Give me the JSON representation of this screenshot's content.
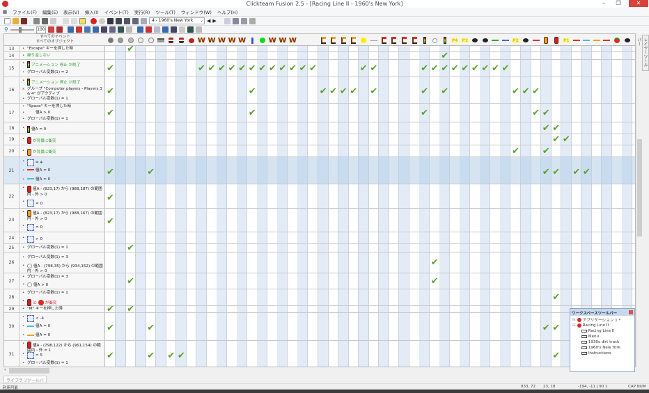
{
  "window": {
    "title": "Clickteam Fusion 2.5 - [Racing Line II - 1960's New York]",
    "minimize": "–",
    "maximize": "❐",
    "close": "✕"
  },
  "menu": [
    "ファイル(F)",
    "編集(E)",
    "表示(V)",
    "挿入(I)",
    "イベント(T)",
    "実行(R)",
    "ツール(T)",
    "ウィンドウ(W)",
    "ヘルプ(H)"
  ],
  "toolbar": {
    "frame_select": "4 - 1960's New York",
    "zoom": "100"
  },
  "header": {
    "events": "すべてのイベント",
    "objects": "すべてのオブジェクト"
  },
  "columns": [
    "gear",
    "spider",
    "storyboard",
    "clock",
    "create",
    "keyboard",
    "joystick",
    "joystick",
    "red-ball",
    "W",
    "W",
    "W",
    "W",
    "W",
    "blue-bar",
    "green-circle",
    "W",
    "W",
    "W",
    "blank",
    "blank",
    "orange-flag",
    "orange-flag",
    "orange-flag",
    "orange-flag",
    "yellow-circle",
    "dash-line",
    "red-flag",
    "red-flag",
    "red-flag",
    "red-flag",
    "traffic-light",
    "circle-outline",
    "traffic-light",
    "P4",
    "P3",
    "black-dot",
    "black-dot",
    "green-line",
    "blue-line",
    "P2",
    "black-dot",
    "red-line",
    "orange-car",
    "red-car",
    "P1",
    "red-line",
    "cyan-line",
    "orange-line",
    "red-line",
    "tomato",
    "black-dot",
    "red-flag"
  ],
  "colors": {
    "check": "#5aa02c",
    "green_text": "#2e9e2e",
    "red_text": "#d42020",
    "selected_row": "#dce8f4",
    "alt_column": "#e3ebf7"
  },
  "rows": [
    {
      "num": "13",
      "checks": [
        2
      ],
      "conds": [
        {
          "b": "•",
          "parts": [
            {
              "text": "\"Escape\" キーを押した時"
            }
          ]
        }
      ]
    },
    {
      "num": "14",
      "checks": [
        33
      ],
      "conds": [
        {
          "b": "•",
          "color": "green",
          "parts": [
            {
              "text": "繰り返しない"
            }
          ]
        }
      ]
    },
    {
      "num": "15",
      "checks": [
        0,
        9,
        10,
        11,
        12,
        13,
        14,
        15,
        16,
        17,
        18,
        19,
        20,
        25,
        26,
        31,
        32,
        33,
        34,
        35,
        36,
        37,
        38,
        39
      ],
      "conds": [
        {
          "b": "•",
          "color": "green",
          "parts": [
            {
              "icon": "traffic-light"
            },
            {
              "text": "アニメーション 停止 が終了"
            }
          ]
        },
        {
          "b": "•",
          "parts": [
            {
              "text": "グローバル変数(1) = 2"
            }
          ]
        }
      ]
    },
    {
      "num": "16",
      "checks": [
        0,
        14,
        21,
        22,
        23,
        24,
        26,
        31,
        33,
        40,
        41,
        42
      ],
      "conds": [
        {
          "b": "•",
          "color": "green",
          "parts": [
            {
              "icon": "traffic-light"
            },
            {
              "text": "アニメーション 停止 が終了"
            }
          ]
        },
        {
          "b": "x",
          "parts": [
            {
              "text": "グループ \"Computer players - Players 3 & 4\" がアクティブ"
            }
          ]
        },
        {
          "b": "•",
          "parts": [
            {
              "text": "グローバル変数(1) = 1"
            }
          ]
        }
      ]
    },
    {
      "num": "17",
      "checks": [
        0,
        14,
        31,
        42,
        43
      ],
      "conds": [
        {
          "b": "•",
          "parts": [
            {
              "text": "\"Space\" キーを押した時"
            }
          ]
        },
        {
          "b": "•",
          "parts": [
            {
              "icon": "dash-line"
            },
            {
              "text": "値A > 0"
            }
          ]
        },
        {
          "b": "•",
          "parts": [
            {
              "text": "グローバル変数(1) = 1"
            }
          ]
        }
      ]
    },
    {
      "num": "18",
      "checks": [
        43,
        44
      ],
      "conds": [
        {
          "b": "•",
          "parts": [
            {
              "icon": "traffic-light"
            },
            {
              "text": "値A = 0"
            }
          ]
        }
      ]
    },
    {
      "num": "19",
      "checks": [
        44,
        45
      ],
      "conds": [
        {
          "b": "•",
          "color": "green",
          "parts": [
            {
              "icon": "red-car"
            },
            {
              "text": "が背景に衝突"
            }
          ]
        }
      ]
    },
    {
      "num": "20",
      "checks": [
        40,
        43
      ],
      "conds": [
        {
          "b": "•",
          "color": "green",
          "parts": [
            {
              "icon": "orange-car"
            },
            {
              "text": "が背景に衝突"
            }
          ]
        }
      ]
    },
    {
      "num": "21",
      "selected": true,
      "checks": [
        0,
        4,
        43,
        44,
        46,
        47
      ],
      "conds": [
        {
          "b": "•",
          "parts": [
            {
              "icon": "blue-counter"
            },
            {
              "text": "= 4"
            }
          ]
        },
        {
          "b": "•",
          "parts": [
            {
              "icon": "red-line"
            },
            {
              "text": "値A = 0"
            }
          ]
        },
        {
          "b": "•",
          "parts": [
            {
              "icon": "cyan-line"
            },
            {
              "text": "値A = 0"
            }
          ]
        }
      ]
    },
    {
      "num": "22",
      "checks": [
        0
      ],
      "conds": [
        {
          "b": "•",
          "parts": [
            {
              "icon": "red-car"
            },
            {
              "text": "値A - (823,17) から (988,187) の範囲内 - 外 > 0"
            }
          ]
        },
        {
          "b": "•",
          "parts": [
            {
              "icon": "blue-counter"
            },
            {
              "text": "= 0"
            }
          ]
        }
      ]
    },
    {
      "num": "23",
      "checks": [
        0
      ],
      "conds": [
        {
          "b": "•",
          "parts": [
            {
              "icon": "orange-car"
            },
            {
              "text": "値A - (823,17) から (988,167) の範囲内 - 外 > 0"
            }
          ]
        },
        {
          "b": "•",
          "parts": [
            {
              "icon": "blue-counter"
            },
            {
              "text": "= 0"
            }
          ]
        }
      ]
    },
    {
      "num": "24",
      "checks": [],
      "conds": [
        {
          "b": "•",
          "parts": [
            {
              "icon": "blue-counter"
            },
            {
              "text": "> 0"
            }
          ]
        }
      ]
    },
    {
      "num": "25",
      "checks": [
        2
      ],
      "conds": [
        {
          "b": "•",
          "parts": [
            {
              "text": "グローバル変数(1) = 1"
            }
          ]
        }
      ]
    },
    {
      "num": "26",
      "checks": [
        32
      ],
      "conds": [
        {
          "b": "•",
          "parts": [
            {
              "text": "グローバル変数(1) = 3"
            }
          ]
        },
        {
          "b": "•",
          "parts": [
            {
              "icon": "circle-outline"
            },
            {
              "text": "値A - (798,35) から (934,152) の範囲内 - 外 > 0"
            }
          ]
        }
      ]
    },
    {
      "num": "27",
      "checks": [
        2,
        32
      ],
      "conds": [
        {
          "b": "•",
          "parts": [
            {
              "text": "グローバル変数(1) = 3"
            }
          ]
        },
        {
          "b": "•",
          "parts": [
            {
              "icon": "circle-outline"
            },
            {
              "text": "値A > 0"
            }
          ]
        }
      ]
    },
    {
      "num": "28",
      "checks": [
        44
      ],
      "conds": [
        {
          "b": "•",
          "parts": [
            {
              "text": "グローバル変数(1) = 1"
            }
          ]
        },
        {
          "b": "•",
          "color": "red",
          "parts": [
            {
              "icon": "red-car"
            },
            {
              "text": "と"
            },
            {
              "icon": "tomato"
            },
            {
              "text": "が衝突"
            }
          ]
        }
      ]
    },
    {
      "num": "29",
      "checks": [
        0,
        2
      ],
      "conds": [
        {
          "b": "•",
          "parts": [
            {
              "text": "\"M\" キーを押した時"
            }
          ]
        }
      ]
    },
    {
      "num": "30",
      "checks": [
        0,
        4,
        43,
        44
      ],
      "conds": [
        {
          "b": "•",
          "parts": [
            {
              "icon": "blue-counter"
            },
            {
              "text": "< -4"
            }
          ]
        },
        {
          "b": "•",
          "parts": [
            {
              "icon": "cyan-line"
            },
            {
              "text": "値A = 0"
            }
          ]
        },
        {
          "b": "•",
          "parts": [
            {
              "icon": "orange-line"
            },
            {
              "text": "値A = 0"
            }
          ]
        }
      ]
    },
    {
      "num": "31",
      "checks": [
        0,
        4,
        6,
        7,
        44
      ],
      "conds": [
        {
          "b": "•",
          "parts": [
            {
              "icon": "red-car"
            },
            {
              "text": "値A - (798,122) から (961,154) の範囲内 - 外 = 1"
            }
          ]
        },
        {
          "b": "•",
          "parts": [
            {
              "icon": "blue-counter"
            },
            {
              "text": "= 5"
            }
          ]
        },
        {
          "b": "•",
          "parts": [
            {
              "text": "グローバル変数(1) = 1"
            }
          ]
        }
      ]
    }
  ],
  "workspace": {
    "title": "ワークスペースツールバー",
    "items": [
      {
        "label": "アプリケーション 1 *",
        "level": 0,
        "icon": "app"
      },
      {
        "label": "Racing Line II",
        "level": 0,
        "icon": "app"
      },
      {
        "label": "Racing Line II",
        "level": 1,
        "icon": "frame"
      },
      {
        "label": "Menu",
        "level": 1,
        "icon": "frame"
      },
      {
        "label": "1930s dirt track",
        "level": 1,
        "icon": "frame"
      },
      {
        "label": "1960's New York",
        "level": 1,
        "icon": "frame"
      },
      {
        "label": "Instructions",
        "level": 1,
        "icon": "frame"
      }
    ]
  },
  "right_tab": "レイヤーツールバー",
  "library_tab": "ライブラリツールバー",
  "status": {
    "text": "利用可能",
    "pos": "833, 72",
    "size": "23, 18",
    "cursor": "-194, -11 | 90 1",
    "keys": "CAP NUM"
  }
}
